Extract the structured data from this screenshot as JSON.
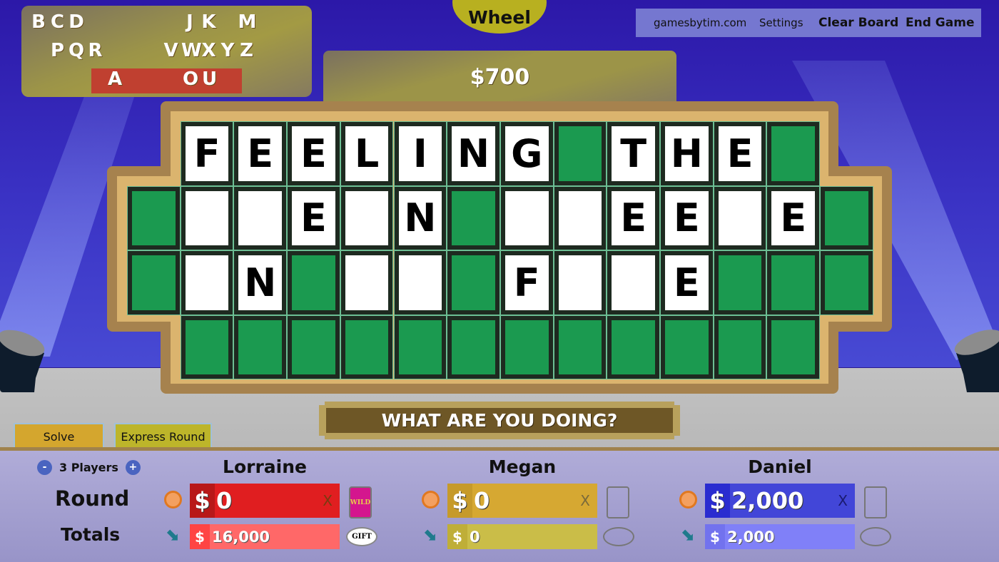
{
  "used_letters": {
    "consonants": [
      {
        "letter": "B",
        "row": 0,
        "col": 0
      },
      {
        "letter": "C",
        "row": 0,
        "col": 1
      },
      {
        "letter": "D",
        "row": 0,
        "col": 2
      },
      {
        "letter": "J",
        "row": 0,
        "col": 8
      },
      {
        "letter": "K",
        "row": 0,
        "col": 9
      },
      {
        "letter": "M",
        "row": 0,
        "col": 11
      },
      {
        "letter": "P",
        "row": 1,
        "col": 1
      },
      {
        "letter": "Q",
        "row": 1,
        "col": 2
      },
      {
        "letter": "R",
        "row": 1,
        "col": 3
      },
      {
        "letter": "V",
        "row": 1,
        "col": 7
      },
      {
        "letter": "W",
        "row": 1,
        "col": 8
      },
      {
        "letter": "X",
        "row": 1,
        "col": 9
      },
      {
        "letter": "Y",
        "row": 1,
        "col": 10
      },
      {
        "letter": "Z",
        "row": 1,
        "col": 11
      }
    ],
    "vowels": [
      {
        "letter": "A",
        "col": 4
      },
      {
        "letter": "O",
        "col": 8
      },
      {
        "letter": "U",
        "col": 9
      }
    ]
  },
  "wheel_button": "Wheel",
  "top_menu": {
    "site": "gamesbytim.com",
    "settings": "Settings",
    "clear_board": "Clear Board",
    "end_game": "End Game"
  },
  "spin_value": "$700",
  "board": {
    "rows": [
      {
        "offset": 1,
        "tiles": [
          "F",
          "E",
          "E",
          "L",
          "I",
          "N",
          "G",
          "#",
          "T",
          "H",
          "E",
          "#"
        ]
      },
      {
        "offset": 0,
        "tiles": [
          "#",
          "_",
          "_",
          "E",
          "_",
          "N",
          "#",
          "_",
          "_",
          "E",
          "E",
          "_",
          "E",
          "#"
        ]
      },
      {
        "offset": 0,
        "tiles": [
          "#",
          "_",
          "N",
          "#",
          "_",
          "_",
          "#",
          "F",
          "_",
          "_",
          "E",
          "#",
          "#",
          "#"
        ]
      },
      {
        "offset": 1,
        "tiles": [
          "#",
          "#",
          "#",
          "#",
          "#",
          "#",
          "#",
          "#",
          "#",
          "#",
          "#",
          "#"
        ]
      }
    ],
    "legend": {
      "#": "unused tile",
      "_": "hidden letter",
      "letter": "revealed letter"
    }
  },
  "category": "WHAT ARE YOU DOING?",
  "buttons": {
    "solve": "Solve",
    "express_round": "Express Round"
  },
  "players_control": {
    "minus": "-",
    "label": "3 Players",
    "plus": "+"
  },
  "row_labels": {
    "round": "Round",
    "totals": "Totals"
  },
  "players": [
    {
      "name": "Lorraine",
      "round_dollar": "$",
      "round": "0",
      "total_dollar": "$",
      "total": "16,000",
      "x": "X",
      "card": "WILD",
      "gift": "GIFT",
      "color": "#e01e20"
    },
    {
      "name": "Megan",
      "round_dollar": "$",
      "round": "0",
      "total_dollar": "$",
      "total": "0",
      "x": "X",
      "card": "",
      "gift": "",
      "color": "#d6a832"
    },
    {
      "name": "Daniel",
      "round_dollar": "$",
      "round": "2,000",
      "total_dollar": "$",
      "total": "2,000",
      "x": "X",
      "card": "",
      "gift": "",
      "color": "#4246d8"
    }
  ]
}
